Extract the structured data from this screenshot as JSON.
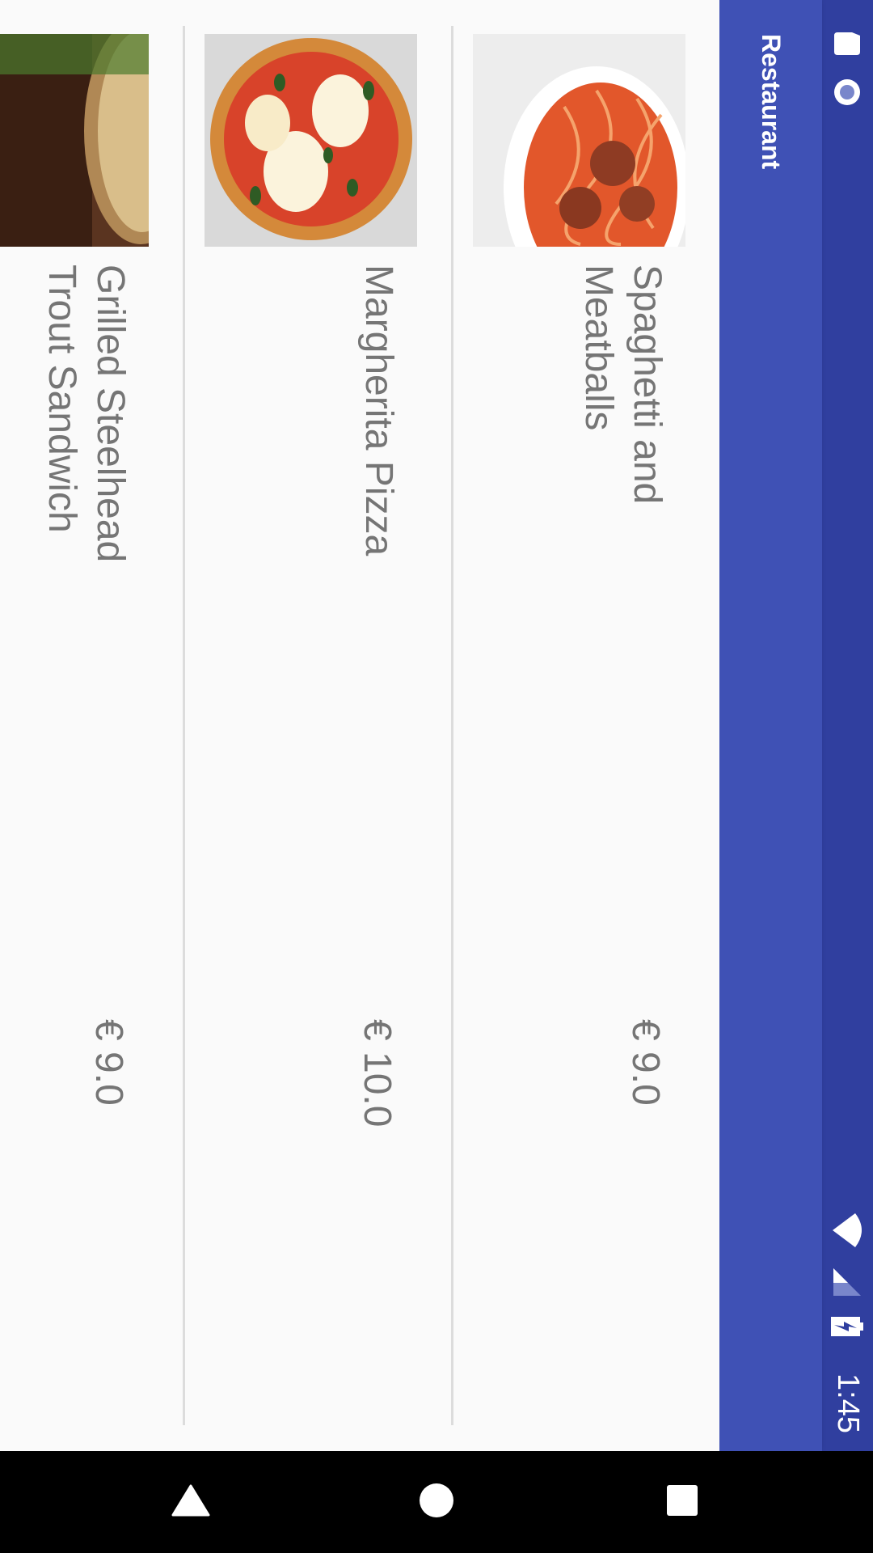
{
  "status_bar": {
    "time": "1:45",
    "icons": [
      "sd-card-icon",
      "recording-icon",
      "wifi-icon",
      "signal-icon",
      "battery-charging-icon"
    ]
  },
  "app_bar": {
    "title": "Restaurant",
    "color": "#3F51B5",
    "status_color": "#303F9F"
  },
  "menu": {
    "items": [
      {
        "name": "Spaghetti and Meatballs",
        "price": "€ 9.0",
        "image": "spaghetti-meatballs-photo"
      },
      {
        "name": "Margherita Pizza",
        "price": "€ 10.0",
        "image": "margherita-pizza-photo"
      },
      {
        "name": "Grilled Steelhead Trout Sandwich",
        "price": "€ 9.0",
        "image": "trout-sandwich-photo"
      }
    ]
  },
  "nav_bar": {
    "buttons": [
      "back-icon",
      "home-icon",
      "recents-icon"
    ]
  }
}
